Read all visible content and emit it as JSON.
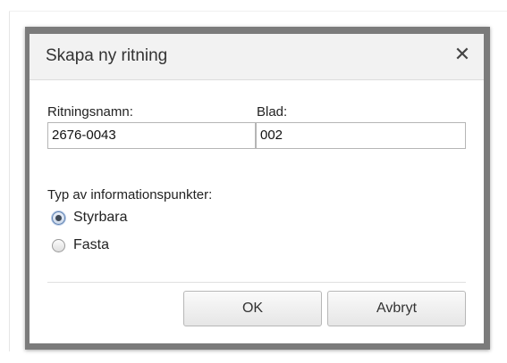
{
  "dialog": {
    "title": "Skapa ny ritning",
    "close_icon": "close-icon",
    "close_glyph": "✕"
  },
  "form": {
    "drawing_name": {
      "label": "Ritningsnamn:",
      "value": "2676-0043"
    },
    "sheet": {
      "label": "Blad:",
      "value": "002"
    },
    "info_points": {
      "label": "Typ av informationspunkter:",
      "options": [
        {
          "label": "Styrbara",
          "selected": true
        },
        {
          "label": "Fasta",
          "selected": false
        }
      ]
    }
  },
  "buttons": {
    "ok": "OK",
    "cancel": "Avbryt"
  },
  "colors": {
    "frame": "#7b7b7b",
    "titlebar": "#f2f2f2",
    "radio_selected": "#5b7fb0"
  }
}
